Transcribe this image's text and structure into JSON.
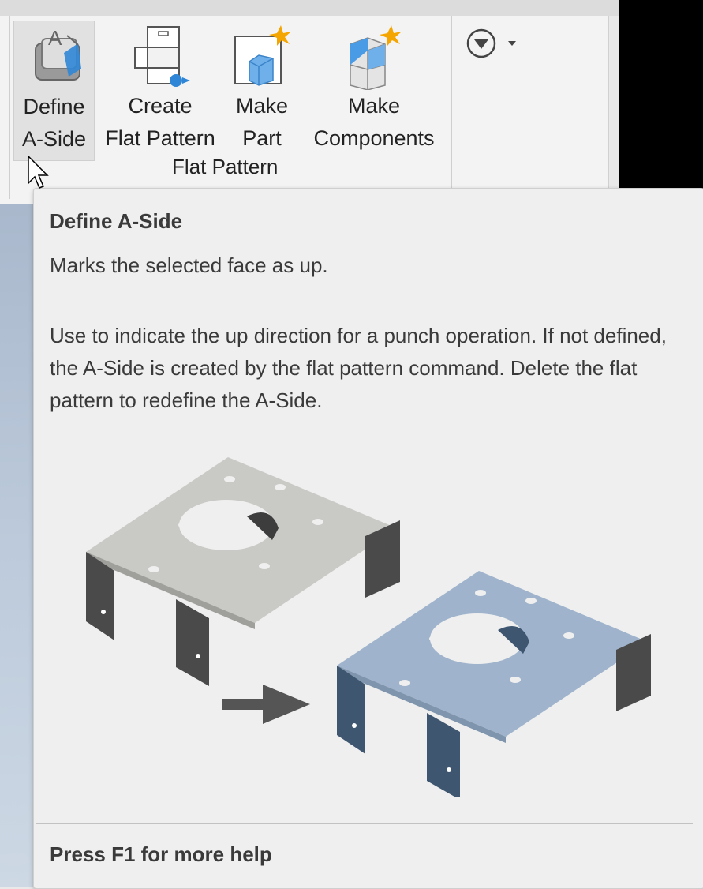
{
  "ribbon": {
    "panel_title": "Flat Pattern",
    "buttons": [
      {
        "line1": "Define",
        "line2": "A-Side",
        "icon": "define-a-side-icon",
        "active": true
      },
      {
        "line1": "Create",
        "line2": "Flat Pattern",
        "icon": "create-flat-pattern-icon"
      },
      {
        "line1": "Make",
        "line2": "Part",
        "icon": "make-part-icon"
      },
      {
        "line1": "Make",
        "line2": "Components",
        "icon": "make-components-icon"
      }
    ],
    "overflow_icon": "circle-down-arrow-icon"
  },
  "tooltip": {
    "title": "Define A-Side",
    "description": "Marks the selected face as up.",
    "detail": "Use to indicate the up direction for a punch operation. If not defined, the A-Side is created by the flat pattern command. Delete the flat pattern to redefine the A-Side.",
    "footer": "Press F1 for more help"
  },
  "colors": {
    "part_gray": "#c9c9c5",
    "part_blue": "#9fb4cc",
    "part_blue_dark": "#3e5670",
    "arrow_gray": "#555555",
    "accent_orange": "#f5a500",
    "icon_blue": "#2f86d6"
  }
}
